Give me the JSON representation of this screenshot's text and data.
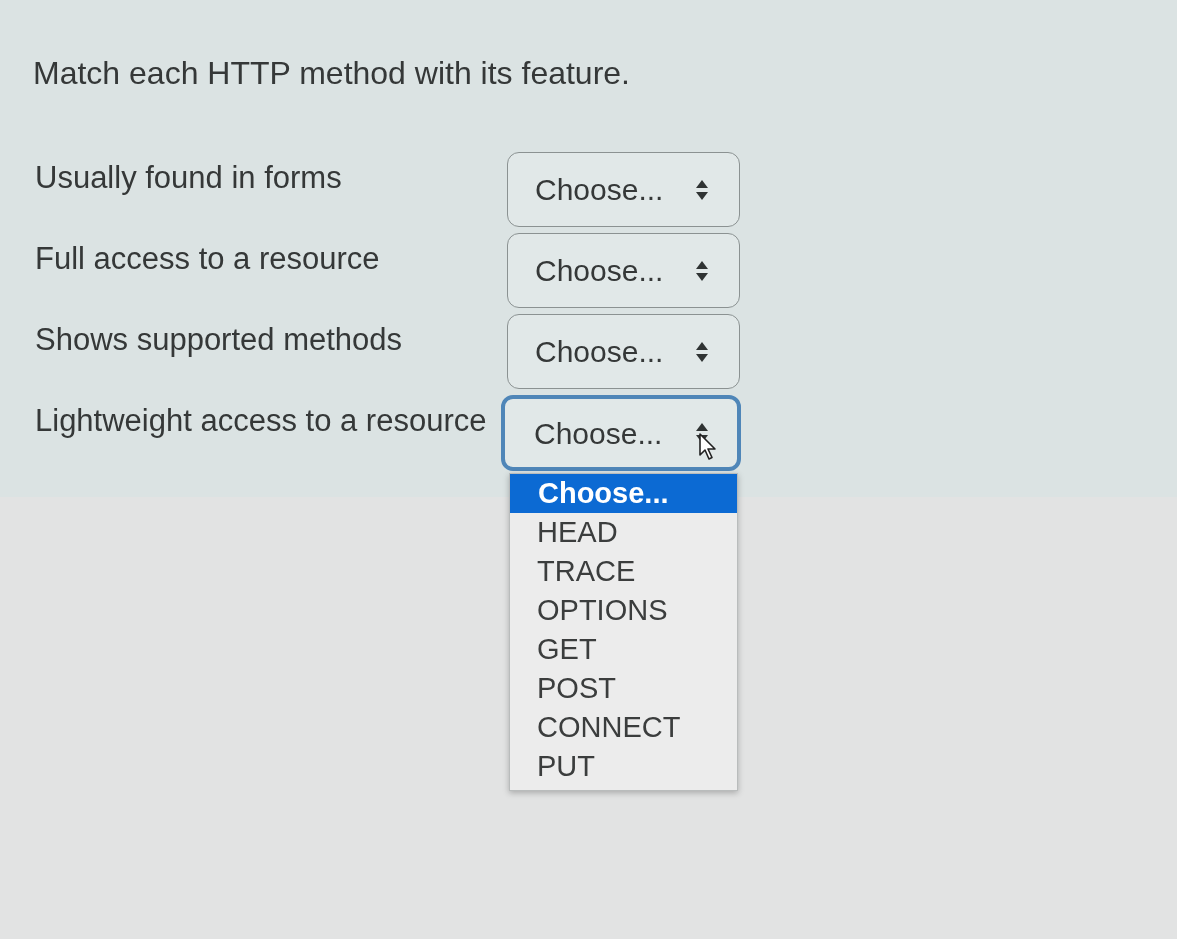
{
  "question": {
    "text": "Match each HTTP method with its feature."
  },
  "items": [
    {
      "label": "Usually found in forms",
      "select": {
        "value": "Choose...",
        "focused": false
      }
    },
    {
      "label": "Full access to a resource",
      "select": {
        "value": "Choose...",
        "focused": false
      }
    },
    {
      "label": "Shows supported methods",
      "select": {
        "value": "Choose...",
        "focused": false
      }
    },
    {
      "label": "Lightweight access to a resource",
      "select": {
        "value": "Choose...",
        "focused": true
      }
    }
  ],
  "dropdown": {
    "options": [
      {
        "label": "Choose...",
        "selected": true
      },
      {
        "label": "HEAD",
        "selected": false
      },
      {
        "label": "TRACE",
        "selected": false
      },
      {
        "label": "OPTIONS",
        "selected": false
      },
      {
        "label": "GET",
        "selected": false
      },
      {
        "label": "POST",
        "selected": false
      },
      {
        "label": "CONNECT",
        "selected": false
      },
      {
        "label": "PUT",
        "selected": false
      }
    ]
  }
}
